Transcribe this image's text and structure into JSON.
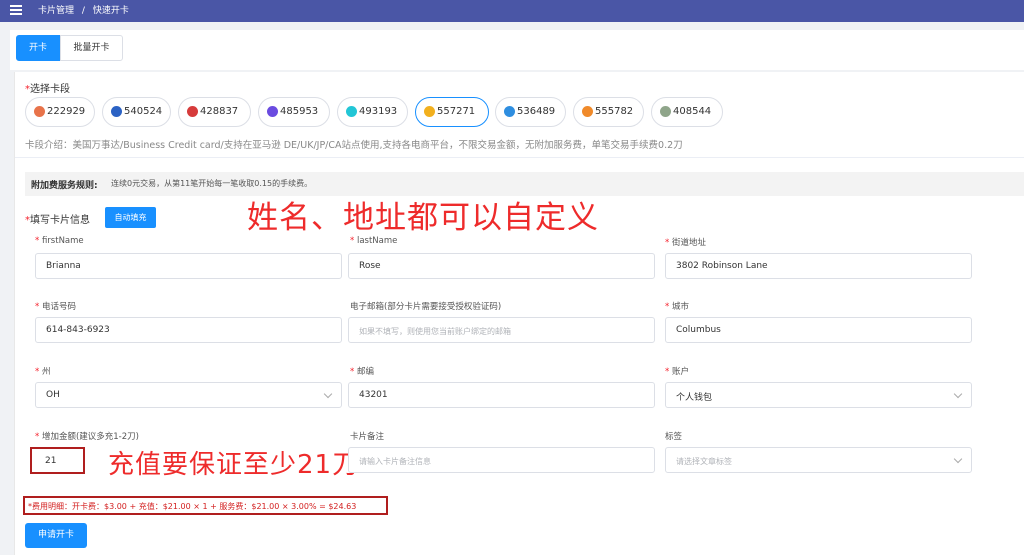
{
  "breadcrumb": [
    "卡片管理",
    "/",
    "快速开卡"
  ],
  "tabs": [
    {
      "label": "开卡",
      "active": true
    },
    {
      "label": "批量开卡",
      "active": false
    }
  ],
  "card_section": {
    "required_mark": "*",
    "title": "选择卡段",
    "chips": [
      {
        "label": "222929",
        "icon": "card-brand-icon",
        "color": "#e8734a",
        "selected": false
      },
      {
        "label": "540524",
        "icon": "card-brand-icon",
        "color": "#2b62c4",
        "selected": false
      },
      {
        "label": "428837",
        "icon": "card-brand-icon",
        "color": "#d63b3b",
        "selected": false
      },
      {
        "label": "485953",
        "icon": "card-brand-icon",
        "color": "#6a4be0",
        "selected": false
      },
      {
        "label": "493193",
        "icon": "card-brand-icon",
        "color": "#22c6d6",
        "selected": false
      },
      {
        "label": "557271",
        "icon": "card-brand-icon",
        "color": "#f2b01e",
        "selected": true
      },
      {
        "label": "536489",
        "icon": "card-brand-icon",
        "color": "#2e8ee0",
        "selected": false
      },
      {
        "label": "555782",
        "icon": "card-brand-icon",
        "color": "#f08a2a",
        "selected": false
      },
      {
        "label": "408544",
        "icon": "card-brand-icon",
        "color": "#8fa58a",
        "selected": false
      }
    ],
    "intro": "卡段介绍：美国万事达/Business Credit card/支持在亚马逊 DE/UK/JP/CA站点使用,支持各电商平台，不限交易金额，无附加服务费，单笔交易手续费0.2刀"
  },
  "rules": {
    "title": "附加费服务规则:",
    "text": "连续0元交易，从第11笔开始每一笔收取0.15的手续费。"
  },
  "fill_section": {
    "required_mark": "*",
    "title": "填写卡片信息",
    "autofill_label": "自动填充"
  },
  "annotations": {
    "top_note": "姓名、地址都可以自定义",
    "amount_note": "充值要保证至少21刀"
  },
  "fields": {
    "first_name": {
      "label": "firstName",
      "required": "*",
      "value": "Brianna"
    },
    "last_name": {
      "label": "lastName",
      "required": "*",
      "value": "Rose"
    },
    "street": {
      "label": "街道地址",
      "required": "*",
      "value": "3802  Robinson Lane"
    },
    "phone": {
      "label": "电话号码",
      "required": "*",
      "value": "614-843-6923"
    },
    "email": {
      "label": "电子邮箱(部分卡片需要接受授权验证码)",
      "placeholder": "如果不填写，则使用您当前账户绑定的邮箱"
    },
    "city": {
      "label": "城市",
      "required": "*",
      "value": "Columbus"
    },
    "state": {
      "label": "州",
      "required": "*",
      "value": "OH"
    },
    "zip": {
      "label": "邮编",
      "required": "*",
      "value": "43201"
    },
    "account": {
      "label": "账户",
      "required": "*",
      "value": "个人钱包"
    },
    "amount": {
      "label": "增加金额(建议多充1-2刀)",
      "required": "*",
      "value": "21"
    },
    "remark": {
      "label": "卡片备注",
      "placeholder": "请输入卡片备注信息"
    },
    "tag": {
      "label": "标签",
      "placeholder": "请选择文章标签"
    }
  },
  "fee_detail": "*费用明细：开卡费：$3.00 + 充值：$21.00 × 1 + 服务费：$21.00 × 3.00% = $24.63",
  "submit_label": "申请开卡",
  "colors": {
    "primary": "#1890ff",
    "topbar": "#4a56a6",
    "annotation": "#ee2b2b",
    "required": "#f5222d"
  }
}
